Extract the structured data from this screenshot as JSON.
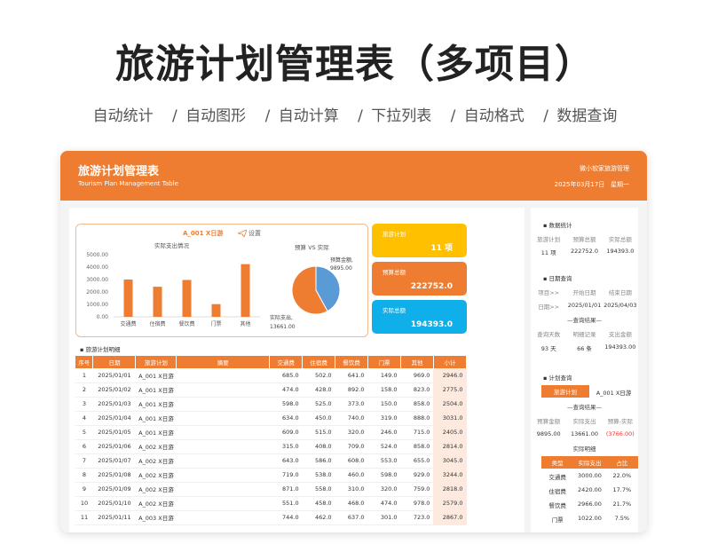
{
  "hero": {
    "title": "旅游计划管理表（多项目）",
    "features": [
      "自动统计",
      "/ 自动图形",
      "/ 自动计算",
      "/ 下拉列表",
      "/ 自动格式",
      "/ 数据查询"
    ]
  },
  "header": {
    "title": "旅游计划管理表",
    "subtitle": "Tourism Plan Management Table",
    "author": "微小软家旅游管理",
    "date": "2025年03月17日",
    "weekday": "星期一"
  },
  "chart_card": {
    "project": "A_001 X日游",
    "setting": "设置",
    "bar_title": "实际支出情况",
    "pie_title": "预算 VS 实际"
  },
  "chart_data": [
    {
      "type": "bar",
      "title": "实际支出情况",
      "categories": [
        "交通费",
        "住宿费",
        "餐饮费",
        "门票",
        "其他"
      ],
      "values": [
        3000,
        2420,
        2966,
        1022,
        4240
      ],
      "yticks": [
        "5000.00",
        "4000.00",
        "3000.00",
        "2000.00",
        "1000.00",
        "0.00"
      ],
      "ylim": [
        0,
        5000
      ],
      "color": "#ee7d31"
    },
    {
      "type": "pie",
      "title": "预算 VS 实际",
      "labels": [
        "预算金额,",
        "实际支出,"
      ],
      "label_values": [
        "9895.00",
        "13661.00"
      ],
      "values": [
        9895,
        13661
      ],
      "colors": [
        "#5b9bd5",
        "#ee7d31"
      ]
    }
  ],
  "kpis": [
    {
      "label": "旅游计划",
      "value": "11 项",
      "color": "#ffc000"
    },
    {
      "label": "预算总额",
      "value": "222752.0",
      "color": "#ee7d31"
    },
    {
      "label": "实际总额",
      "value": "194393.0",
      "color": "#0fb0ea"
    }
  ],
  "table": {
    "section_label": "旅游计划明细",
    "headers": [
      "序号",
      "日期",
      "旅游计划",
      "摘要",
      "交通费",
      "住宿费",
      "餐饮费",
      "门票",
      "其他",
      "小计"
    ],
    "rows": [
      [
        "1",
        "2025/01/01",
        "A_001 X日游",
        "",
        "685.0",
        "502.0",
        "641.0",
        "149.0",
        "969.0",
        "2946.0"
      ],
      [
        "2",
        "2025/01/02",
        "A_001 X日游",
        "",
        "474.0",
        "428.0",
        "892.0",
        "158.0",
        "823.0",
        "2775.0"
      ],
      [
        "3",
        "2025/01/03",
        "A_001 X日游",
        "",
        "598.0",
        "525.0",
        "373.0",
        "150.0",
        "858.0",
        "2504.0"
      ],
      [
        "4",
        "2025/01/04",
        "A_001 X日游",
        "",
        "634.0",
        "450.0",
        "740.0",
        "319.0",
        "888.0",
        "3031.0"
      ],
      [
        "5",
        "2025/01/05",
        "A_001 X日游",
        "",
        "609.0",
        "515.0",
        "320.0",
        "246.0",
        "715.0",
        "2405.0"
      ],
      [
        "6",
        "2025/01/06",
        "A_002 X日游",
        "",
        "315.0",
        "408.0",
        "709.0",
        "524.0",
        "858.0",
        "2814.0"
      ],
      [
        "7",
        "2025/01/07",
        "A_002 X日游",
        "",
        "643.0",
        "586.0",
        "608.0",
        "553.0",
        "655.0",
        "3045.0"
      ],
      [
        "8",
        "2025/01/08",
        "A_002 X日游",
        "",
        "719.0",
        "538.0",
        "460.0",
        "598.0",
        "929.0",
        "3244.0"
      ],
      [
        "9",
        "2025/01/09",
        "A_002 X日游",
        "",
        "871.0",
        "558.0",
        "310.0",
        "320.0",
        "759.0",
        "2818.0"
      ],
      [
        "10",
        "2025/01/10",
        "A_002 X日游",
        "",
        "551.0",
        "458.0",
        "468.0",
        "474.0",
        "978.0",
        "2579.0"
      ],
      [
        "11",
        "2025/01/11",
        "A_003 X日游",
        "",
        "744.0",
        "462.0",
        "637.0",
        "301.0",
        "723.0",
        "2867.0"
      ]
    ]
  },
  "side": {
    "stats_label": "数据统计",
    "stats_headers": [
      "旅游计划",
      "预算总额",
      "实际总额"
    ],
    "stats_values": [
      "11 项",
      "222752.0",
      "194393.0"
    ],
    "date_label": "日期查询",
    "date_headers": [
      "项目>>",
      "开始日期",
      "结束日期"
    ],
    "date_values": [
      "日期>>",
      "2025/01/01",
      "2025/04/03"
    ],
    "result_label": "—查询结果—",
    "result_headers": [
      "查询天数",
      "明细记录",
      "支出金额"
    ],
    "result_values": [
      "93 天",
      "66 条",
      "194393.00"
    ],
    "plan_label": "计划查询",
    "plan_key": "旅游计划",
    "plan_value": "A_001 X日游",
    "plan_result_label": "—查询结果—",
    "plan_headers": [
      "预算金额",
      "实际支出",
      "预算-实际"
    ],
    "plan_values": [
      "9895.00",
      "13661.00",
      "(3766.00)"
    ],
    "detail_label": "实际明细",
    "detail_headers": [
      "类型",
      "实际支出",
      "占比"
    ],
    "detail_rows": [
      [
        "交通费",
        "3000.00",
        "22.0%"
      ],
      [
        "住宿费",
        "2420.00",
        "17.7%"
      ],
      [
        "餐饮费",
        "2966.00",
        "21.7%"
      ],
      [
        "门票",
        "1022.00",
        "7.5%"
      ]
    ]
  }
}
